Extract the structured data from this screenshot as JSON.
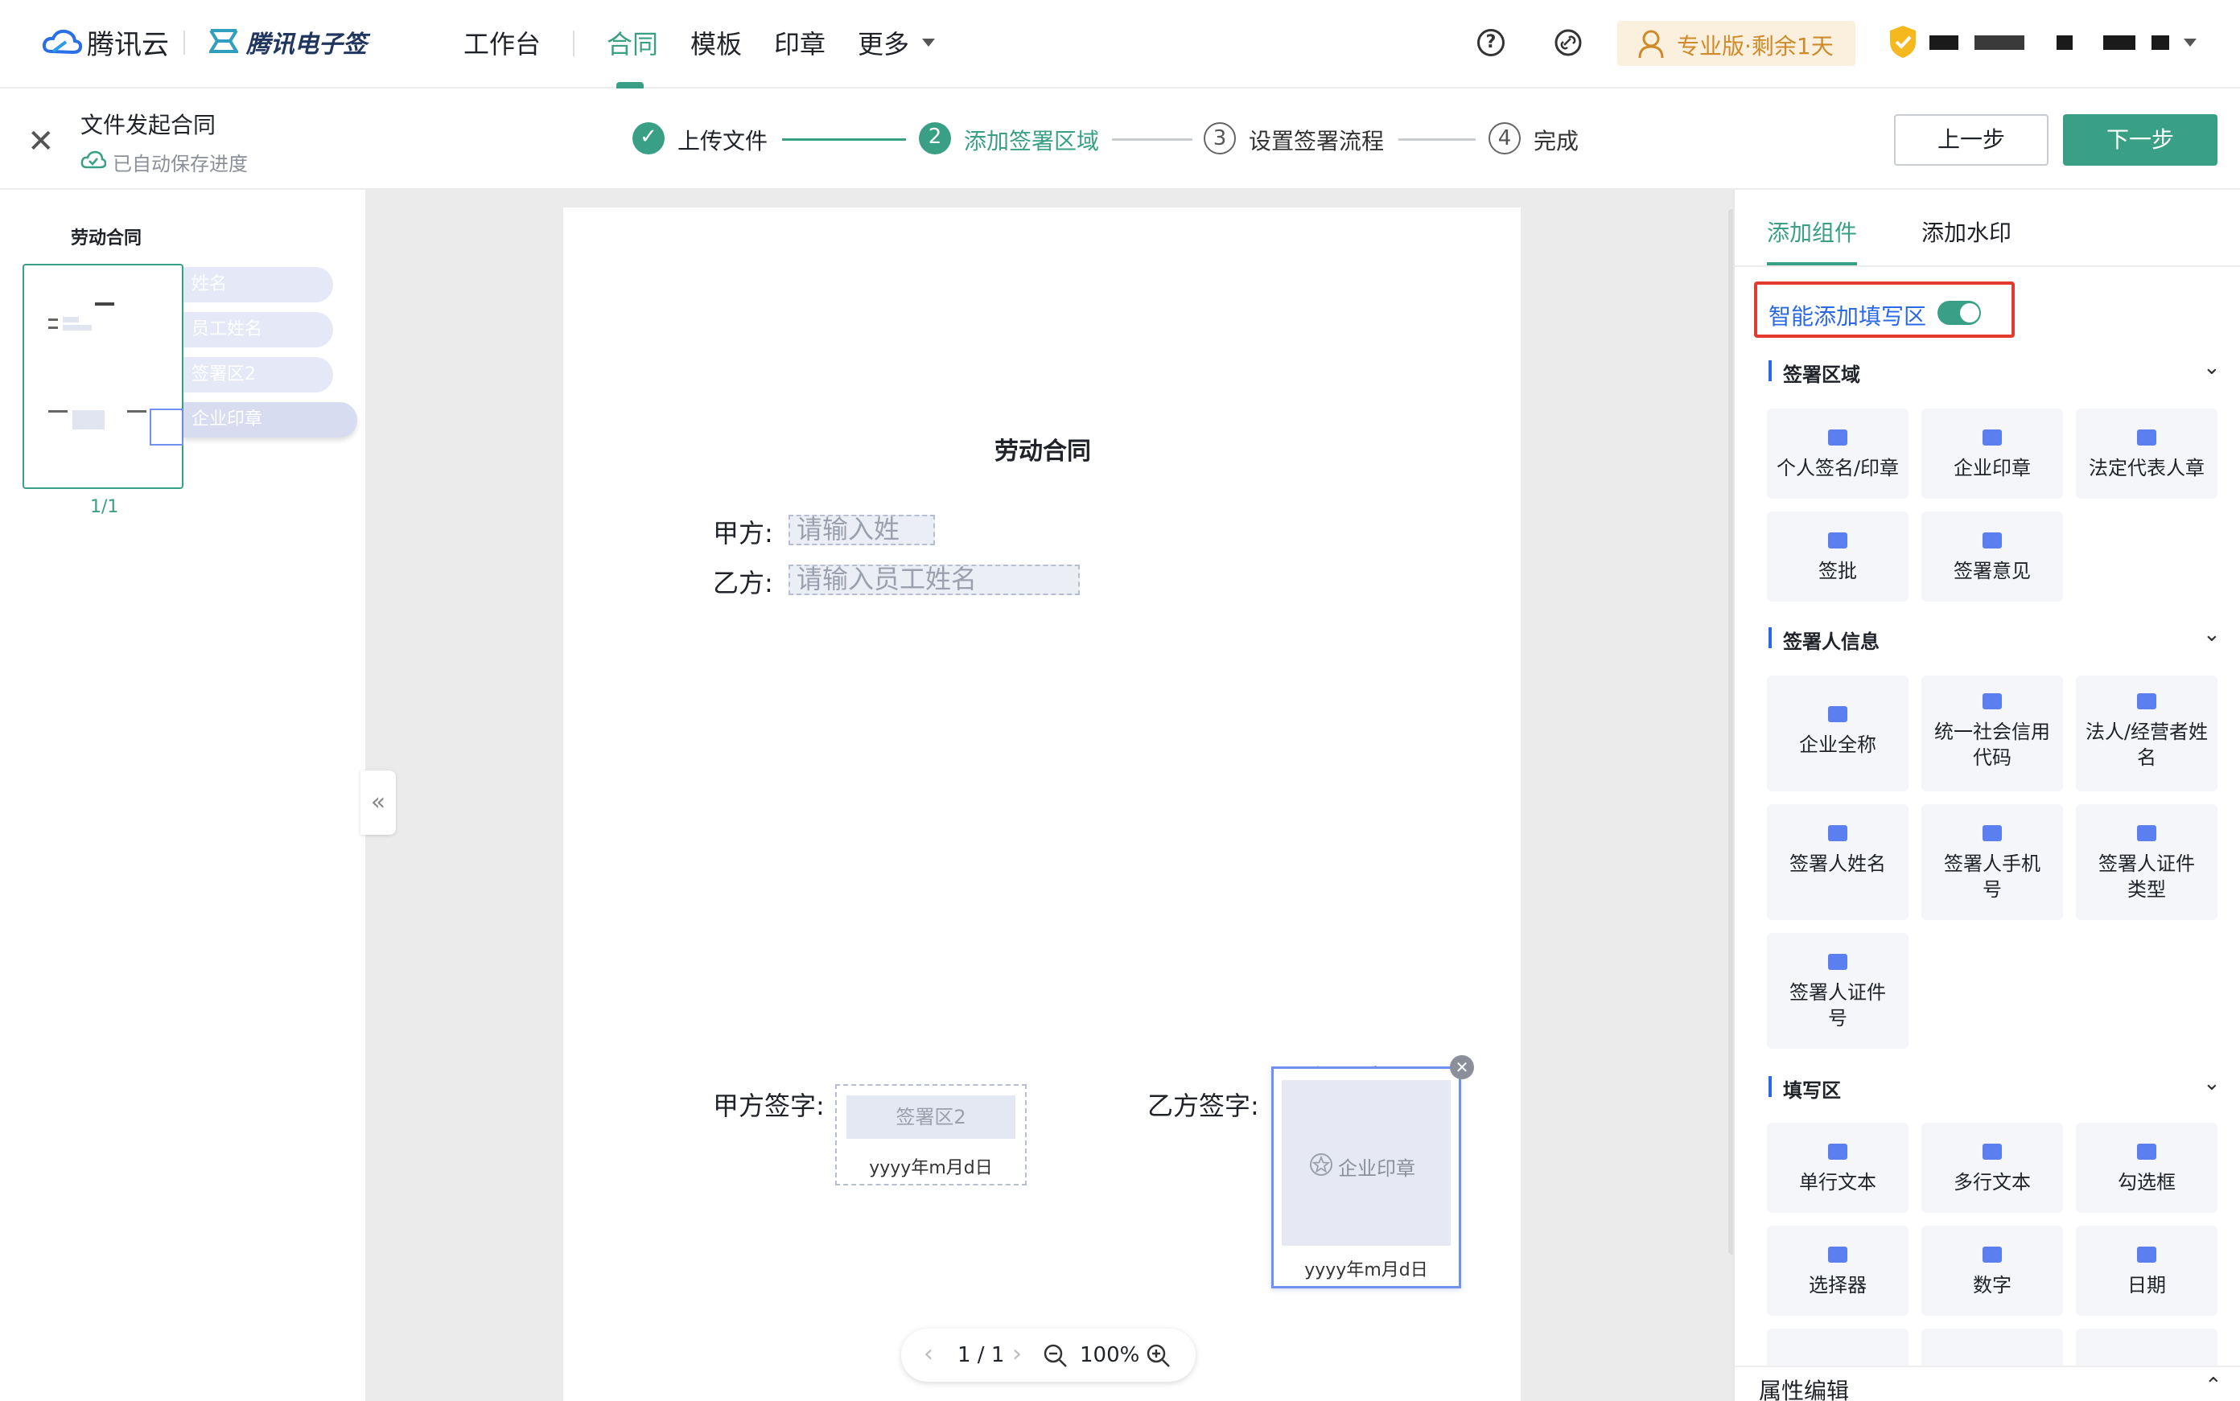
{
  "topnav": {
    "logo_text": "腾讯云",
    "product_text": "腾讯电子签",
    "items": [
      "工作台",
      "合同",
      "模板",
      "印章",
      "更多"
    ],
    "active_item": "合同",
    "plan_text": "专业版·剩余1天"
  },
  "stepbar": {
    "doc_title": "文件发起合同",
    "save_status": "已自动保存进度",
    "steps": [
      {
        "num": "✓",
        "label": "上传文件"
      },
      {
        "num": "2",
        "label": "添加签署区域"
      },
      {
        "num": "3",
        "label": "设置签署流程"
      },
      {
        "num": "4",
        "label": "完成"
      }
    ],
    "prev_label": "上一步",
    "next_label": "下一步"
  },
  "thumbs": {
    "doc_name": "劳动合同",
    "page_count": "1/1",
    "chips": [
      "姓名",
      "员工姓名",
      "签署区2",
      "企业印章"
    ]
  },
  "document": {
    "title": "劳动合同",
    "party_a_label": "甲方:",
    "party_a_placeholder": "请输入姓",
    "party_b_label": "乙方:",
    "party_b_placeholder": "请输入员工姓名",
    "sign_a_label": "甲方签字:",
    "sign_a_area": "签署区2",
    "sign_a_date": "yyyy年m月d日",
    "sign_b_label": "乙方签字:",
    "seal_required_mark": "*",
    "seal_title": "企业印章",
    "seal_inner": "企业印章",
    "seal_date": "yyyy年m月d日"
  },
  "zoom": {
    "page": "1 / 1",
    "level": "100%"
  },
  "rightpanel": {
    "tabs": [
      "添加组件",
      "添加水印"
    ],
    "smart_fill": "智能添加填写区",
    "smart_fill_on": true,
    "sections": [
      {
        "title": "签署区域",
        "items": [
          "个人签名/印章",
          "企业印章",
          "法定代表人章",
          "签批",
          "签署意见"
        ]
      },
      {
        "title": "签署人信息",
        "items": [
          "企业全称",
          "统一社会信用代码",
          "法人/经营者姓名",
          "签署人姓名",
          "签署人手机号",
          "签署人证件类型",
          "签署人证件号"
        ]
      },
      {
        "title": "填写区",
        "items": [
          "单行文本",
          "多行文本",
          "勾选框",
          "选择器",
          "数字",
          "日期"
        ]
      }
    ],
    "property_title": "属性编辑"
  },
  "colors": {
    "accent": "#3aa085",
    "link_blue": "#2a68e8",
    "highlight_red": "#e33a2e"
  }
}
